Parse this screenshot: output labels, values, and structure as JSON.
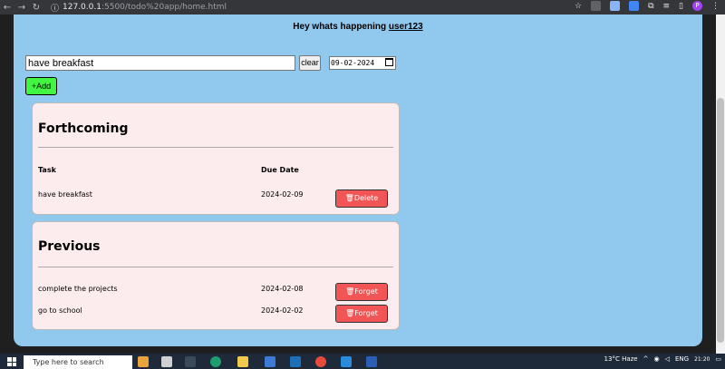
{
  "browser": {
    "url_host": "127.0.0.1",
    "url_path": ":5500/todo%20app/home.html"
  },
  "header": {
    "greeting": "Hey whats happening",
    "username": "user123"
  },
  "form": {
    "task_value": "have breakfast",
    "clear_label": "clear",
    "date_value": "09-02-2024",
    "add_label": "+Add"
  },
  "forthcoming": {
    "title": "Forthcoming",
    "col_task": "Task",
    "col_due": "Due Date",
    "rows": [
      {
        "task": "have breakfast",
        "date": "2024-02-09",
        "action": "🗑Delete"
      }
    ]
  },
  "previous": {
    "title": "Previous",
    "rows": [
      {
        "task": "complete the projects",
        "date": "2024-02-08",
        "action": "🗑Forget"
      },
      {
        "task": "go to school",
        "date": "2024-02-02",
        "action": "🗑Forget"
      }
    ]
  },
  "taskbar": {
    "search_placeholder": "Type here to search",
    "weather": "13°C Haze",
    "lang": "ENG",
    "time": "21:20"
  },
  "colors": {
    "app_bg": "#90c8ee",
    "add_green": "#43f543",
    "action_red": "#f25555",
    "panel_pink": "#fdecee"
  }
}
